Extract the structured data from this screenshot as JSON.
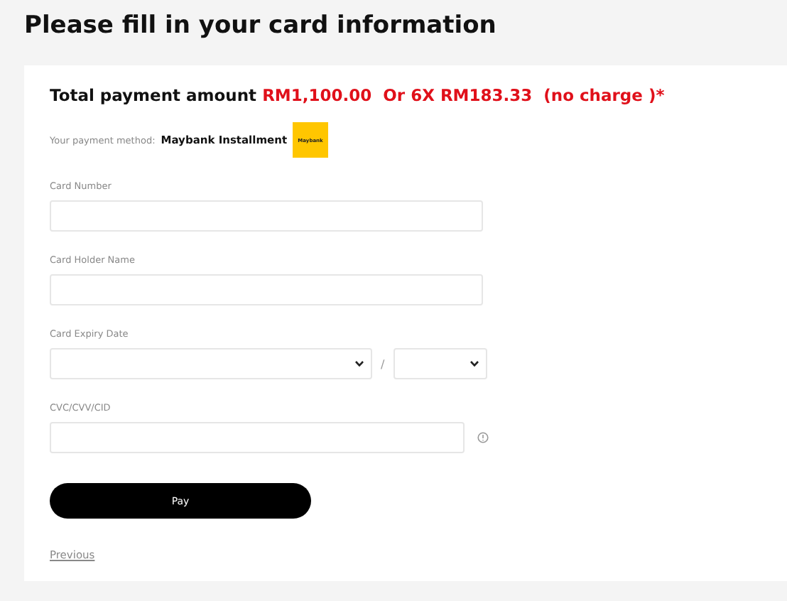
{
  "title": "Please fill in your card information",
  "total": {
    "label": "Total payment amount",
    "amount": "RM1,100.00  Or 6X RM183.33  (no charge )*"
  },
  "payment_method": {
    "label": "Your payment method:",
    "name": "Maybank Installment",
    "logo_text": "Maybank"
  },
  "fields": [
    {
      "kind": "text",
      "label": "Card Number"
    },
    {
      "kind": "text",
      "label": "Card Holder Name"
    },
    {
      "kind": "expiry",
      "label": "Card Expiry Date",
      "separator": "/"
    },
    {
      "kind": "cvc",
      "label": "CVC/CVV/CID"
    }
  ],
  "pay_button": "Pay",
  "previous_link": "Previous"
}
